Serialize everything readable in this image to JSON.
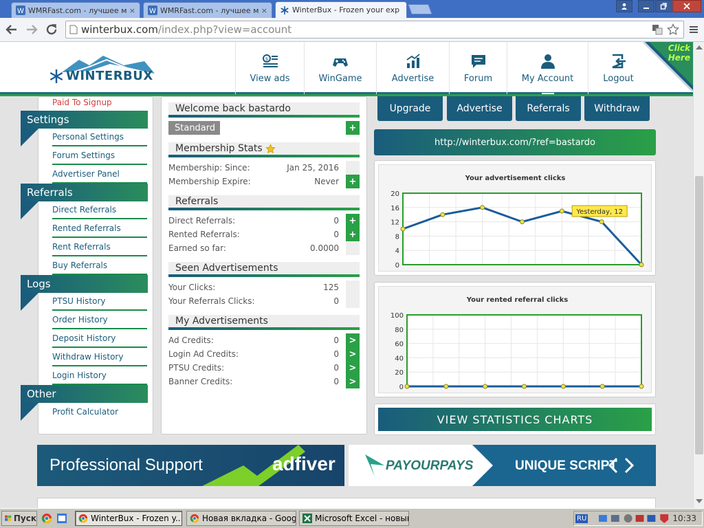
{
  "browser": {
    "tabs": [
      {
        "title": "WMRFast.com - лучшее мес"
      },
      {
        "title": "WMRFast.com - лучшее мес"
      },
      {
        "title": "WinterBux - Frozen your exp"
      }
    ],
    "tab_close": "×",
    "url_host": "winterbux.com",
    "url_path": "/index.php?view=account"
  },
  "site": {
    "logo_text": "WINTERBUX",
    "nav": [
      {
        "label": "View ads",
        "icon": "dollar-list-icon"
      },
      {
        "label": "WinGame",
        "icon": "gamepad-icon"
      },
      {
        "label": "Advertise",
        "icon": "bar-chart-icon"
      },
      {
        "label": "Forum",
        "icon": "chat-icon"
      },
      {
        "label": "My Account",
        "icon": "user-icon"
      },
      {
        "label": "Logout",
        "icon": "logout-icon"
      }
    ],
    "click_here": "Click Here"
  },
  "sidebar": {
    "top_link": "Paid To Signup",
    "sections": [
      {
        "title": "Settings",
        "items": [
          "Personal Settings",
          "Forum Settings",
          "Advertiser Panel"
        ]
      },
      {
        "title": "Referrals",
        "items": [
          "Direct Referrals",
          "Rented Referrals",
          "Rent Referrals",
          "Buy Referrals"
        ]
      },
      {
        "title": "Logs",
        "items": [
          "PTSU History",
          "Order History",
          "Deposit History",
          "Withdraw History",
          "Login History"
        ]
      },
      {
        "title": "Other",
        "items": [
          "Profit Calculator"
        ]
      }
    ]
  },
  "account": {
    "welcome": "Welcome back bastardo",
    "membership_type": "Standard",
    "plus": "+",
    "arrow": ">",
    "membership_stats": {
      "title": "Membership Stats",
      "since_label": "Membership: Since:",
      "since_value": "Jan 25, 2016",
      "expire_label": "Membership Expire:",
      "expire_value": "Never"
    },
    "referrals": {
      "title": "Referrals",
      "direct_label": "Direct Referrals:",
      "direct_value": "0",
      "rented_label": "Rented Referrals:",
      "rented_value": "0",
      "earned_label": "Earned so far:",
      "earned_value": "0.0000"
    },
    "seen_ads": {
      "title": "Seen Advertisements",
      "clicks_label": "Your Clicks:",
      "clicks_value": "125",
      "ref_clicks_label": "Your Referrals Clicks:",
      "ref_clicks_value": "0"
    },
    "my_ads": {
      "title": "My Advertisements",
      "ad_label": "Ad Credits:",
      "ad_value": "0",
      "login_label": "Login Ad Credits:",
      "login_value": "0",
      "ptsu_label": "PTSU Credits:",
      "ptsu_value": "0",
      "banner_label": "Banner Credits:",
      "banner_value": "0"
    }
  },
  "right": {
    "buttons": [
      "Upgrade",
      "Advertise",
      "Referrals",
      "Withdraw"
    ],
    "ref_link": "http://winterbux.com/?ref=bastardo",
    "tooltip": "Yesterday, 12",
    "stats_button": "VIEW STATISTICS CHARTS"
  },
  "chart_data": [
    {
      "type": "line",
      "title": "Your advertisement clicks",
      "x": [
        1,
        2,
        3,
        4,
        5,
        6,
        7
      ],
      "values": [
        10,
        14,
        16,
        12,
        15,
        12,
        0
      ],
      "ylim": [
        0,
        20
      ],
      "yticks": [
        0,
        4,
        8,
        12,
        16,
        20
      ],
      "grid": true,
      "color": "#1a5c9a"
    },
    {
      "type": "line",
      "title": "Your rented referral clicks",
      "x": [
        1,
        2,
        3,
        4,
        5,
        6,
        7
      ],
      "values": [
        0,
        0,
        0,
        0,
        0,
        0,
        0
      ],
      "ylim": [
        0,
        100
      ],
      "yticks": [
        0,
        20,
        40,
        60,
        80,
        100
      ],
      "grid": true,
      "color": "#1a5c9a"
    }
  ],
  "banners": {
    "left_text": "Professional Support",
    "left_brand": "adfiver",
    "right_brand": "PAYOURPAYS",
    "right_text": "UNIQUE SCRIPT"
  },
  "taskbar": {
    "start": "Пуск",
    "tasks": [
      "WinterBux - Frozen y...",
      "Новая вкладка - Google...",
      "Microsoft Excel - новый ..."
    ],
    "lang": "RU",
    "clock": "10:33"
  },
  "colors": {
    "brand_blue": "#1a5c7c",
    "brand_green": "#2aa047",
    "tooltip": "#ffe84d"
  }
}
